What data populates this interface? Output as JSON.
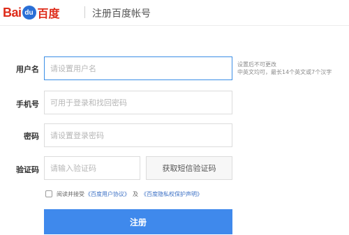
{
  "header": {
    "logo": {
      "latin": "Bai",
      "paw_text": "du",
      "chinese": "百度"
    },
    "title": "注册百度帐号"
  },
  "form": {
    "username": {
      "label": "用户名",
      "placeholder": "请设置用户名",
      "hint_line1": "设置后不可更改",
      "hint_line2": "中英文均可，最长14个英文或7个汉字"
    },
    "phone": {
      "label": "手机号",
      "placeholder": "可用于登录和找回密码"
    },
    "password": {
      "label": "密码",
      "placeholder": "请设置登录密码"
    },
    "verification": {
      "label": "验证码",
      "placeholder": "请输入验证码",
      "sms_button_label": "获取短信验证码"
    },
    "agreement": {
      "prefix": "阅读并接受",
      "link1": "《百度用户协议》",
      "conjunction": "及",
      "link2": "《百度隐私权保护声明》"
    },
    "submit_label": "注册"
  },
  "colors": {
    "brand_red": "#de2a18",
    "brand_blue": "#2a6fd6",
    "primary_button": "#3f89ec",
    "focus_border": "#3a8ee6",
    "link": "#3a6fc4"
  }
}
